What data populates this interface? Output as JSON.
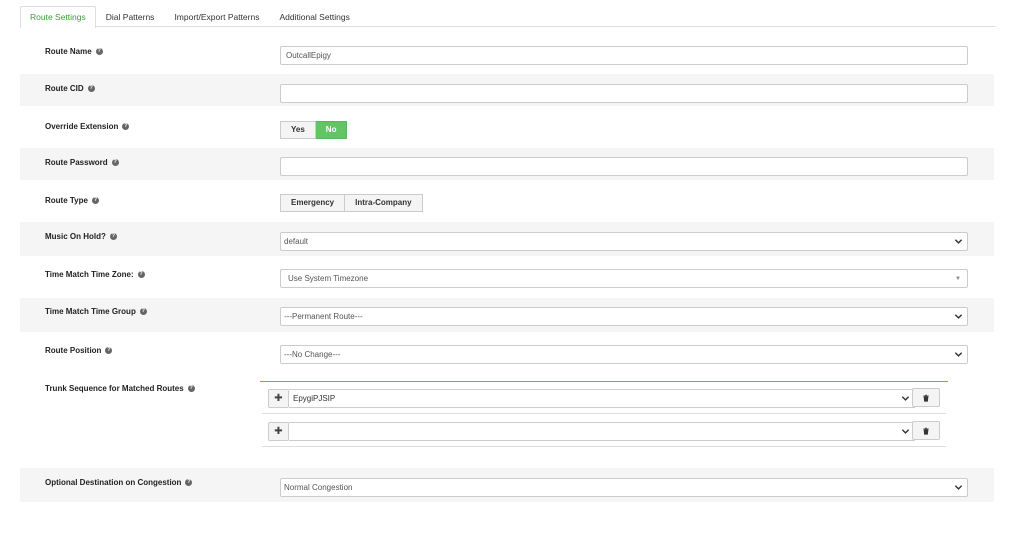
{
  "tabs": [
    {
      "label": "Route Settings",
      "active": true
    },
    {
      "label": "Dial Patterns",
      "active": false
    },
    {
      "label": "Import/Export Patterns",
      "active": false
    },
    {
      "label": "Additional Settings",
      "active": false
    }
  ],
  "route_name": {
    "label": "Route Name",
    "value": "OutcallEpigy"
  },
  "route_cid": {
    "label": "Route CID",
    "value": ""
  },
  "override_extension": {
    "label": "Override Extension",
    "options": [
      "Yes",
      "No"
    ],
    "selected": "No"
  },
  "route_password": {
    "label": "Route Password",
    "value": ""
  },
  "route_type": {
    "label": "Route Type",
    "options": [
      "Emergency",
      "Intra-Company"
    ]
  },
  "music_on_hold": {
    "label": "Music On Hold?",
    "value": "default"
  },
  "time_zone": {
    "label": "Time Match Time Zone:",
    "value": "Use System Timezone"
  },
  "time_group": {
    "label": "Time Match Time Group",
    "value": "---Permanent Route---"
  },
  "route_position": {
    "label": "Route Position",
    "value": "---No Change---"
  },
  "trunk_sequence": {
    "label": "Trunk Sequence for Matched Routes",
    "trunks": [
      "EpygiPJSIP",
      ""
    ]
  },
  "congestion": {
    "label": "Optional Destination on Congestion",
    "value": "Normal Congestion"
  },
  "accent_color": "#62c462"
}
